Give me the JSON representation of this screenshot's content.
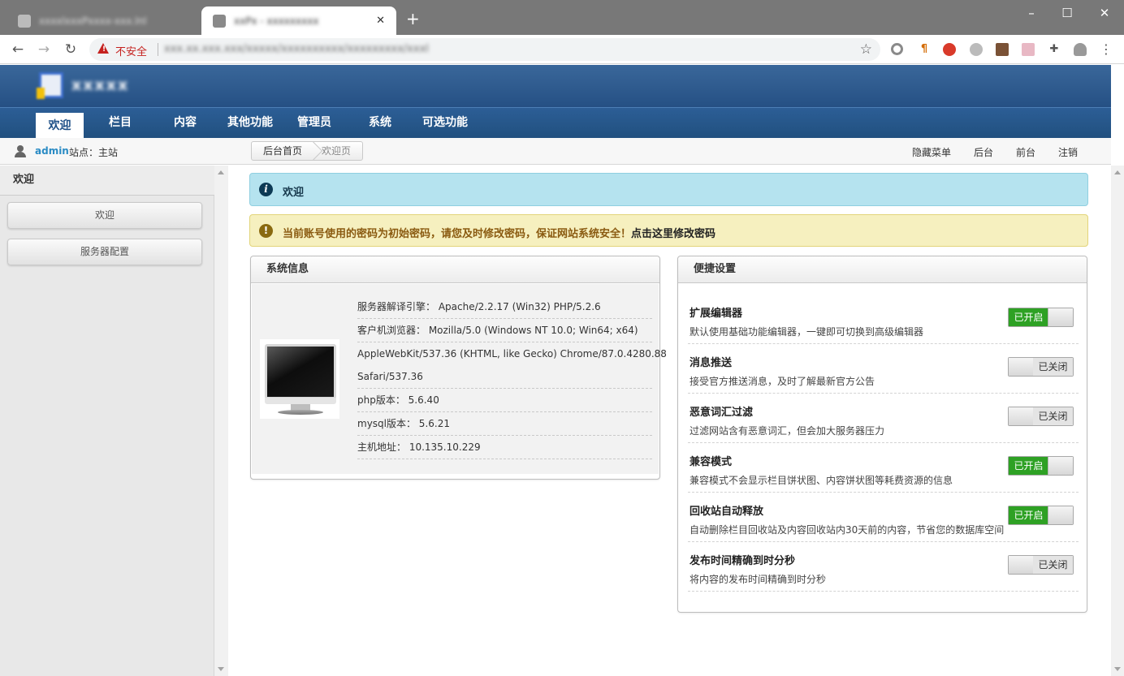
{
  "browser": {
    "tabs": [
      {
        "title": "xxxxlxxxPxxxx-xxx.lnl",
        "active": false
      },
      {
        "title": "xxPx - xxxxxxxxx",
        "active": true
      }
    ],
    "new_tab": "+",
    "window_controls": {
      "minimize": "–",
      "maximize": "☐",
      "close": "✕"
    },
    "security_label": "不安全",
    "url": "xxx.xx.xxx.xxx/xxxxx/xxxxxxxxxx/xxxxxxxxx/xxxl",
    "nav": {
      "back": "←",
      "forward": "→",
      "reload": "↻",
      "bookmark": "☆",
      "menu": "⋮"
    }
  },
  "header": {
    "logo_text": "xxxxx"
  },
  "menu": {
    "items": [
      {
        "label": "欢迎",
        "active": true
      },
      {
        "label": "栏目",
        "active": false
      },
      {
        "label": "内容",
        "active": false
      },
      {
        "label": "其他功能",
        "active": false
      },
      {
        "label": "管理员",
        "active": false
      },
      {
        "label": "系统",
        "active": false
      },
      {
        "label": "可选功能",
        "active": false
      }
    ]
  },
  "subbar": {
    "username": "admin",
    "site": "站点：主站",
    "breadcrumb": [
      "后台首页",
      "欢迎页"
    ],
    "links": [
      "隐藏菜单",
      "后台",
      "前台",
      "注销"
    ]
  },
  "sidebar": {
    "title": "欢迎",
    "buttons": [
      "欢迎",
      "服务器配置"
    ]
  },
  "alerts": {
    "info": "欢迎",
    "warning_text": "当前账号使用的密码为初始密码，请您及时修改密码，保证网站系统安全！",
    "warning_link": "点击这里修改密码"
  },
  "sysinfo": {
    "title": "系统信息",
    "rows": [
      "服务器解译引擎： Apache/2.2.17 (Win32) PHP/5.2.6",
      "客户机浏览器： Mozilla/5.0 (Windows NT 10.0; Win64; x64)",
      "AppleWebKit/537.36 (KHTML, like Gecko) Chrome/87.0.4280.88",
      "Safari/537.36",
      "php版本： 5.6.40",
      "mysql版本： 5.6.21",
      "主机地址： 10.135.10.229"
    ]
  },
  "quick": {
    "title": "便捷设置",
    "items": [
      {
        "title": "扩展编辑器",
        "desc": "默认使用基础功能编辑器，一键即可切换到高级编辑器",
        "state": "已开启",
        "on": true
      },
      {
        "title": "消息推送",
        "desc": "接受官方推送消息，及时了解最新官方公告",
        "state": "已关闭",
        "on": false
      },
      {
        "title": "恶意词汇过滤",
        "desc": "过滤网站含有恶意词汇，但会加大服务器压力",
        "state": "已关闭",
        "on": false
      },
      {
        "title": "兼容模式",
        "desc": "兼容模式不会显示栏目饼状图、内容饼状图等耗费资源的信息",
        "state": "已开启",
        "on": true
      },
      {
        "title": "回收站自动释放",
        "desc": "自动删除栏目回收站及内容回收站内30天前的内容，节省您的数据库空间",
        "state": "已开启",
        "on": true
      },
      {
        "title": "发布时间精确到时分秒",
        "desc": "将内容的发布时间精确到时分秒",
        "state": "已关闭",
        "on": false
      }
    ]
  },
  "colors": {
    "header_blue": "#2f5b8a",
    "toggle_on": "#2ea124",
    "info_bg": "#b5e3ef",
    "warn_bg": "#f6f0bf"
  }
}
